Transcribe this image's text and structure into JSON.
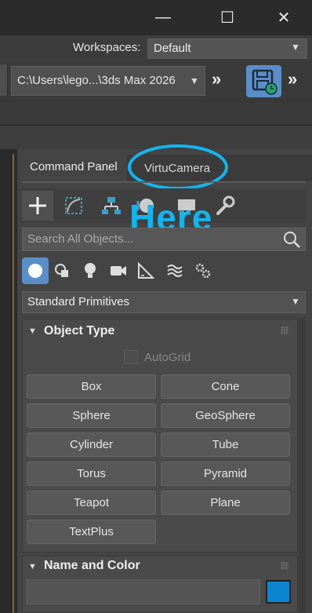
{
  "window": {
    "minimize_glyph": "—",
    "maximize_glyph": "☐",
    "close_glyph": "✕"
  },
  "workspaces": {
    "label": "Workspaces:",
    "value": "Default"
  },
  "project_path": {
    "value": "C:\\Users\\lego...\\3ds Max 2026",
    "more_glyph": "»"
  },
  "panel": {
    "tabs": [
      {
        "label": "Command Panel"
      },
      {
        "label": "VirtuCamera"
      }
    ],
    "annotation": "Here",
    "command_icons": [
      "create-icon",
      "modify-icon",
      "hierarchy-icon",
      "motion-icon",
      "display-icon",
      "utilities-icon"
    ],
    "search_placeholder": "Search All Objects...",
    "category_icons": [
      "geometry-icon",
      "shapes-icon",
      "lights-icon",
      "cameras-icon",
      "helpers-icon",
      "space-warps-icon",
      "systems-icon"
    ],
    "primitive_type": "Standard Primitives"
  },
  "object_type": {
    "title": "Object Type",
    "autogrid_label": "AutoGrid",
    "buttons": [
      "Box",
      "Cone",
      "Sphere",
      "GeoSphere",
      "Cylinder",
      "Tube",
      "Torus",
      "Pyramid",
      "Teapot",
      "Plane",
      "TextPlus"
    ]
  },
  "name_and_color": {
    "title": "Name and Color",
    "name_value": "",
    "color": "#0b85d0"
  },
  "colors": {
    "accent_blue": "#5a8ec9",
    "annotation_cyan": "#14b4ee"
  }
}
